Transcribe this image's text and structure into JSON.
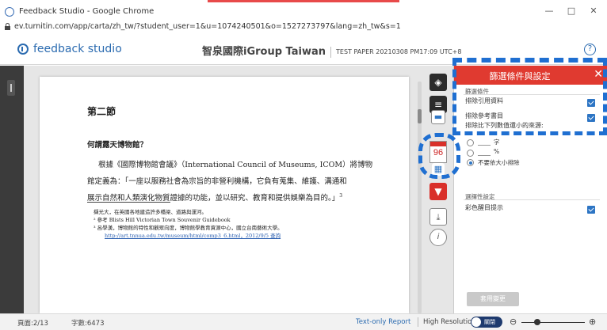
{
  "browser": {
    "title": "Feedback Studio - Google Chrome",
    "url": "ev.turnitin.com/app/carta/zh_tw/?student_user=1&u=1074240501&o=1527273797&lang=zh_tw&s=1",
    "controls": {
      "minimize": "—",
      "restore": "□",
      "close": "✕"
    }
  },
  "header": {
    "product": "feedback studio",
    "school": "智泉國際iGroup Taiwan",
    "paper": "TEST PAPER 20210308 PM17:09 UTC+8",
    "help": "?"
  },
  "document": {
    "section_heading": "第二節",
    "question": "何謂露天博物館？",
    "paragraph": [
      "根據《國際博物館會議》（International Council of Museums, ICOM）將博物",
      "館定義為：「一座以服務社會為宗旨的非營利機構，它負有蒐集、維護、溝通和",
      "展示自然和人類演化物質證據的功能，並以研究、教育和提供娛樂為目的。」"
    ],
    "paragraph_sup": "3",
    "footnotes": [
      "擷光大，在英國各地建造許多橋梁、道路與運河。",
      "² 參考 Blists Hill Victorian Town Souvenir Guidebook",
      "³ 呂學漢，博物館的特性和觀眾向度，博物館學教育資源中心，國立台南藝術大學。",
      "http://art.tnnua.edu.tw/museum/html/comp3_6.html，2012/9/5 查詢"
    ]
  },
  "tools": {
    "score": "96",
    "layers_icon": "layers-icon",
    "comment_icon": "comment-icon",
    "filter_icon": "filter-icon",
    "download_icon": "download-icon",
    "info_icon": "info-icon"
  },
  "filter_panel": {
    "title": "篩選條件與設定",
    "close": "✕",
    "filter_section": "篩選條件",
    "options": [
      {
        "label": "排除引用資料",
        "checked": true
      },
      {
        "label": "排除參考書目",
        "checked": true
      },
      {
        "label": "排除比下列數值還小的來源:",
        "checked": false
      }
    ],
    "unit_words": "字",
    "unit_percent": "%",
    "no_exclude": "不要依大小排除",
    "optional_section": "選擇性設定",
    "color_highlight": "彩色醒目提示",
    "apply": "套用變更"
  },
  "status": {
    "page": "頁面:2/13",
    "words": "字數:6473",
    "text_only": "Text-only Report",
    "high_res": "High Resolution",
    "toggle_state": "關閉",
    "zoom_out": "⊖",
    "zoom_in": "⊕",
    "zoom_level": 0.25
  },
  "colors": {
    "accent_red": "#e03a30",
    "brand_blue": "#2b6bb0",
    "annotation_blue": "#1f6fd1",
    "checkbox_blue": "#2d75c4"
  }
}
